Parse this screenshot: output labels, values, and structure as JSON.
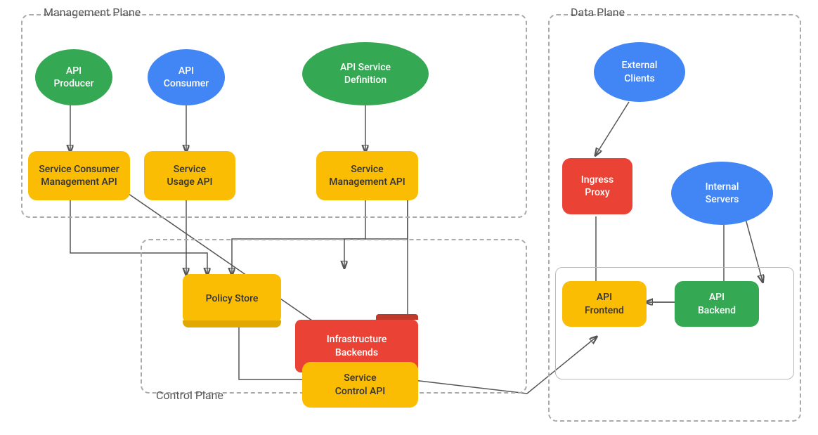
{
  "panels": {
    "management": {
      "label": "Management Plane"
    },
    "data": {
      "label": "Data Plane"
    },
    "control": {
      "label": "Control Plane"
    }
  },
  "nodes": {
    "api_producer": {
      "label": "API\nProducer"
    },
    "api_consumer": {
      "label": "API\nConsumer"
    },
    "api_service_def": {
      "label": "API Service\nDefinition"
    },
    "service_consumer_mgmt": {
      "label": "Service Consumer\nManagement API"
    },
    "service_usage_api": {
      "label": "Service\nUsage API"
    },
    "service_management_api": {
      "label": "Service\nManagement API"
    },
    "policy_store": {
      "label": "Policy Store"
    },
    "infra_backends": {
      "label": "Infrastructure\nBackends"
    },
    "service_control_api": {
      "label": "Service\nControl API"
    },
    "external_clients": {
      "label": "External\nClients"
    },
    "ingress_proxy": {
      "label": "Ingress\nProxy"
    },
    "internal_servers": {
      "label": "Internal\nServers"
    },
    "api_frontend": {
      "label": "API\nFrontend"
    },
    "api_backend": {
      "label": "API\nBackend"
    }
  }
}
